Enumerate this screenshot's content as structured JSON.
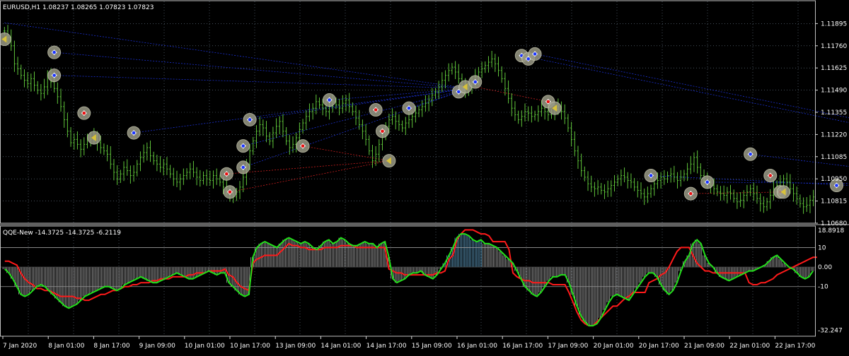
{
  "window": {
    "main_label": "EURUSD,H1  1.08237 1.08265 1.07823 1.07823",
    "indicator_label": "QQE-New -14.3725 -14.3725 -6.2119"
  },
  "colors": {
    "background": "#000000",
    "grid": "#6e7f8f",
    "bars": "#5fc53a",
    "blue_lines": "#1a2fcf",
    "red_lines": "#c81e1e",
    "qqe_fast": "#22e01a",
    "qqe_slow": "#ff1a1a",
    "histogram": "#d8d8d8",
    "histogram_alt": "#7fd0ff",
    "separator": "#c0c0c0"
  },
  "chart_data": [
    {
      "type": "candlestick",
      "symbol": "EURUSD",
      "timeframe": "H1",
      "title": "EURUSD,H1  1.08237 1.08265 1.07823 1.07823",
      "ylim": [
        1.1068,
        1.1203
      ],
      "y_ticks": [
        "1.11895",
        "1.11760",
        "1.11625",
        "1.11490",
        "1.11355",
        "1.11220",
        "1.11085",
        "1.10950",
        "1.10815",
        "1.10680"
      ],
      "x_ticks": [
        "7 Jan 2020",
        "8 Jan 01:00",
        "8 Jan 17:00",
        "9 Jan 09:00",
        "10 Jan 01:00",
        "10 Jan 17:00",
        "13 Jan 09:00",
        "14 Jan 01:00",
        "14 Jan 17:00",
        "15 Jan 09:00",
        "16 Jan 01:00",
        "16 Jan 17:00",
        "17 Jan 09:00",
        "20 Jan 01:00",
        "20 Jan 17:00",
        "21 Jan 09:00",
        "22 Jan 01:00",
        "22 Jan 17:00"
      ],
      "close": [
        1.1185,
        1.1181,
        1.1176,
        1.1165,
        1.1162,
        1.1158,
        1.1155,
        1.1153,
        1.1156,
        1.1152,
        1.1149,
        1.1147,
        1.1151,
        1.1158,
        1.1154,
        1.115,
        1.1145,
        1.1139,
        1.1131,
        1.1124,
        1.1117,
        1.1119,
        1.1116,
        1.1113,
        1.1116,
        1.112,
        1.1119,
        1.1121,
        1.1117,
        1.1114,
        1.1112,
        1.111,
        1.1104,
        1.1099,
        1.1095,
        1.1098,
        1.1102,
        1.11,
        1.1097,
        1.1099,
        1.1104,
        1.1108,
        1.1111,
        1.1114,
        1.1109,
        1.1106,
        1.1104,
        1.1102,
        1.1104,
        1.1101,
        1.1098,
        1.1095,
        1.1093,
        1.1095,
        1.1097,
        1.1099,
        1.1101,
        1.1099,
        1.1096,
        1.1094,
        1.1097,
        1.1095,
        1.1094,
        1.1097,
        1.1095,
        1.1093,
        1.109,
        1.1088,
        1.1086,
        1.1084,
        1.1087,
        1.109,
        1.1096,
        1.1104,
        1.1112,
        1.1118,
        1.1124,
        1.1128,
        1.1126,
        1.1121,
        1.1118,
        1.1123,
        1.1127,
        1.113,
        1.1124,
        1.1118,
        1.1114,
        1.1116,
        1.112,
        1.1125,
        1.1129,
        1.1133,
        1.1136,
        1.1138,
        1.1142,
        1.114,
        1.1138,
        1.1136,
        1.1139,
        1.1142,
        1.114,
        1.1138,
        1.1141,
        1.1143,
        1.1139,
        1.1136,
        1.1132,
        1.1128,
        1.1124,
        1.1119,
        1.1112,
        1.1106,
        1.111,
        1.1116,
        1.1121,
        1.1127,
        1.1131,
        1.1133,
        1.113,
        1.1128,
        1.1126,
        1.1129,
        1.1131,
        1.1133,
        1.1135,
        1.1137,
        1.1139,
        1.1141,
        1.1143,
        1.1146,
        1.1148,
        1.1151,
        1.1155,
        1.1158,
        1.1161,
        1.1163,
        1.116,
        1.1156,
        1.1152,
        1.1148,
        1.1151,
        1.1154,
        1.1157,
        1.116,
        1.1162,
        1.1164,
        1.1166,
        1.1168,
        1.1165,
        1.1161,
        1.1156,
        1.115,
        1.1144,
        1.1138,
        1.1134,
        1.1131,
        1.1133,
        1.1136,
        1.1135,
        1.1133,
        1.1134,
        1.1136,
        1.1138,
        1.1136,
        1.1134,
        1.1135,
        1.1137,
        1.1139,
        1.1136,
        1.1132,
        1.1126,
        1.1119,
        1.1112,
        1.1106,
        1.11,
        1.1096,
        1.1092,
        1.109,
        1.1089,
        1.109,
        1.1088,
        1.1087,
        1.1089,
        1.1091,
        1.1093,
        1.1095,
        1.1097,
        1.1096,
        1.1094,
        1.1093,
        1.109,
        1.1088,
        1.1086,
        1.1084,
        1.1086,
        1.1089,
        1.1092,
        1.1094,
        1.1096,
        1.1095,
        1.1097,
        1.1098,
        1.1096,
        1.1094,
        1.1096,
        1.1098,
        1.1101,
        1.1104,
        1.1108,
        1.1102,
        1.1097,
        1.1094,
        1.1092,
        1.1091,
        1.1089,
        1.1087,
        1.1086,
        1.1085,
        1.1087,
        1.1086,
        1.1083,
        1.1081,
        1.1082,
        1.1085,
        1.1087,
        1.1089,
        1.1086,
        1.1083,
        1.108,
        1.1078,
        1.1081,
        1.1085,
        1.1089,
        1.1091,
        1.1093,
        1.1095,
        1.1093,
        1.1089,
        1.1086,
        1.1083,
        1.108,
        1.1078,
        1.1079,
        1.1082,
        1.1084
      ],
      "arrows": [
        {
          "i": 0,
          "p": 1.118,
          "k": "close"
        },
        {
          "i": 15,
          "p": 1.1172,
          "k": "buy"
        },
        {
          "i": 15,
          "p": 1.1158,
          "k": "buy"
        },
        {
          "i": 24,
          "p": 1.1135,
          "k": "sell"
        },
        {
          "i": 27,
          "p": 1.112,
          "k": "close"
        },
        {
          "i": 39,
          "p": 1.1123,
          "k": "buy"
        },
        {
          "i": 67,
          "p": 1.1098,
          "k": "sell"
        },
        {
          "i": 68,
          "p": 1.1087,
          "k": "sell"
        },
        {
          "i": 72,
          "p": 1.1102,
          "k": "buy"
        },
        {
          "i": 72,
          "p": 1.1115,
          "k": "buy"
        },
        {
          "i": 74,
          "p": 1.1131,
          "k": "buy"
        },
        {
          "i": 90,
          "p": 1.1115,
          "k": "sell"
        },
        {
          "i": 98,
          "p": 1.1143,
          "k": "buy"
        },
        {
          "i": 112,
          "p": 1.1137,
          "k": "sell"
        },
        {
          "i": 114,
          "p": 1.1124,
          "k": "sell"
        },
        {
          "i": 116,
          "p": 1.1106,
          "k": "close"
        },
        {
          "i": 122,
          "p": 1.1138,
          "k": "buy"
        },
        {
          "i": 137,
          "p": 1.1148,
          "k": "buy"
        },
        {
          "i": 139,
          "p": 1.1151,
          "k": "close"
        },
        {
          "i": 142,
          "p": 1.1154,
          "k": "buy"
        },
        {
          "i": 156,
          "p": 1.117,
          "k": "buy"
        },
        {
          "i": 158,
          "p": 1.1168,
          "k": "buy"
        },
        {
          "i": 160,
          "p": 1.1171,
          "k": "buy"
        },
        {
          "i": 164,
          "p": 1.1142,
          "k": "sell"
        },
        {
          "i": 166,
          "p": 1.1138,
          "k": "close"
        },
        {
          "i": 195,
          "p": 1.1097,
          "k": "buy"
        },
        {
          "i": 207,
          "p": 1.1086,
          "k": "sell"
        },
        {
          "i": 212,
          "p": 1.1093,
          "k": "buy"
        },
        {
          "i": 225,
          "p": 1.111,
          "k": "buy"
        },
        {
          "i": 231,
          "p": 1.1097,
          "k": "sell"
        },
        {
          "i": 234,
          "p": 1.1087,
          "k": "sell"
        },
        {
          "i": 235,
          "p": 1.1087,
          "k": "close"
        },
        {
          "i": 251,
          "p": 1.1091,
          "k": "buy"
        },
        {
          "i": 265,
          "p": 1.1086,
          "k": "sell"
        }
      ]
    },
    {
      "type": "line",
      "title": "QQE-New -14.3725 -14.3725 -6.2119",
      "ylim": [
        -35.4,
        21.0
      ],
      "y_ticks": [
        "18.8918",
        "10",
        "0.00",
        "-10",
        "-32.247"
      ],
      "levels": [
        10,
        -10
      ],
      "series": [
        {
          "name": "fast",
          "values": [
            -1,
            -3,
            -6,
            -10,
            -14,
            -15,
            -14,
            -12,
            -10,
            -9,
            -10,
            -12,
            -14,
            -16,
            -18,
            -20,
            -21,
            -20,
            -19,
            -17,
            -15,
            -14,
            -13,
            -12,
            -11,
            -10,
            -10,
            -11,
            -12,
            -11,
            -9,
            -8,
            -7,
            -6,
            -5,
            -6,
            -7,
            -8,
            -8,
            -7,
            -6,
            -5,
            -4,
            -3,
            -4,
            -5,
            -6,
            -6,
            -5,
            -4,
            -3,
            -2,
            -3,
            -4,
            -3,
            -3,
            -8,
            -10,
            -12,
            -14,
            -15,
            -14,
            5,
            10,
            12,
            13,
            12,
            11,
            10,
            12,
            14,
            15,
            14,
            13,
            12,
            13,
            12,
            10,
            9,
            11,
            13,
            14,
            12,
            13,
            15,
            14,
            12,
            11,
            11,
            12,
            13,
            12,
            12,
            10,
            12,
            13,
            5,
            -6,
            -8,
            -7,
            -6,
            -4,
            -3,
            -3,
            -2,
            -4,
            -5,
            -6,
            -4,
            -1,
            2,
            6,
            10,
            15,
            17,
            17,
            16,
            14,
            13,
            14,
            12,
            12,
            11,
            10,
            8,
            6,
            4,
            2,
            -2,
            -6,
            -10,
            -12,
            -14,
            -15,
            -13,
            -10,
            -7,
            -5,
            -5,
            -4,
            -4,
            -8,
            -14,
            -20,
            -25,
            -28,
            -30,
            -30,
            -29,
            -26,
            -22,
            -18,
            -15,
            -14,
            -15,
            -16,
            -17,
            -14,
            -11,
            -8,
            -5,
            -3,
            -3,
            -5,
            -9,
            -12,
            -14,
            -12,
            -8,
            -2,
            3,
            6,
            12,
            14,
            12,
            6,
            2,
            0,
            -3,
            -5,
            -6,
            -7,
            -6,
            -5,
            -4,
            -3,
            -2,
            -2,
            -1,
            0,
            1,
            3,
            5,
            6,
            4,
            2,
            0,
            -1,
            -3,
            -5,
            -6,
            -5,
            -2
          ]
        },
        {
          "name": "slow",
          "values": [
            3,
            3,
            2,
            1,
            -3,
            -6,
            -8,
            -9,
            -11,
            -11,
            -12,
            -12,
            -13,
            -14,
            -15,
            -15,
            -15,
            -15,
            -16,
            -16,
            -17,
            -17,
            -16,
            -15,
            -14,
            -14,
            -13,
            -12,
            -12,
            -11,
            -10,
            -10,
            -9,
            -9,
            -8,
            -8,
            -8,
            -7,
            -7,
            -6,
            -6,
            -6,
            -5,
            -5,
            -5,
            -5,
            -4,
            -4,
            -3,
            -3,
            -3,
            -2,
            -2,
            -2,
            -2,
            -1,
            -4,
            -5,
            -8,
            -10,
            -11,
            -12,
            2,
            4,
            5,
            6,
            6,
            6,
            6,
            8,
            10,
            12,
            11,
            11,
            10,
            10,
            9,
            9,
            9,
            9,
            10,
            10,
            10,
            10,
            11,
            11,
            11,
            11,
            10,
            10,
            10,
            10,
            10,
            10,
            10,
            10,
            -1,
            -2,
            -3,
            -3,
            -4,
            -4,
            -4,
            -4,
            -4,
            -4,
            -4,
            -4,
            -3,
            -3,
            -2,
            4,
            6,
            14,
            17,
            19,
            19,
            19,
            18,
            17,
            17,
            16,
            13,
            13,
            13,
            13,
            9,
            -3,
            -5,
            -6,
            -7,
            -7,
            -8,
            -8,
            -8,
            -8,
            -8,
            -9,
            -9,
            -9,
            -9,
            -13,
            -18,
            -23,
            -27,
            -29,
            -30,
            -30,
            -28,
            -26,
            -24,
            -22,
            -20,
            -20,
            -18,
            -16,
            -15,
            -13,
            -13,
            -13,
            -13,
            -8,
            -7,
            -6,
            -4,
            -3,
            0,
            4,
            8,
            10,
            10,
            10,
            6,
            2,
            0,
            -2,
            -2,
            -3,
            -3,
            -3,
            -3,
            -3,
            -3,
            -3,
            -3,
            -3,
            -8,
            -9,
            -9,
            -8,
            -8,
            -7,
            -6,
            -4,
            -3,
            -2,
            -1,
            0,
            1,
            2,
            3,
            4,
            5,
            5
          ]
        }
      ]
    }
  ]
}
